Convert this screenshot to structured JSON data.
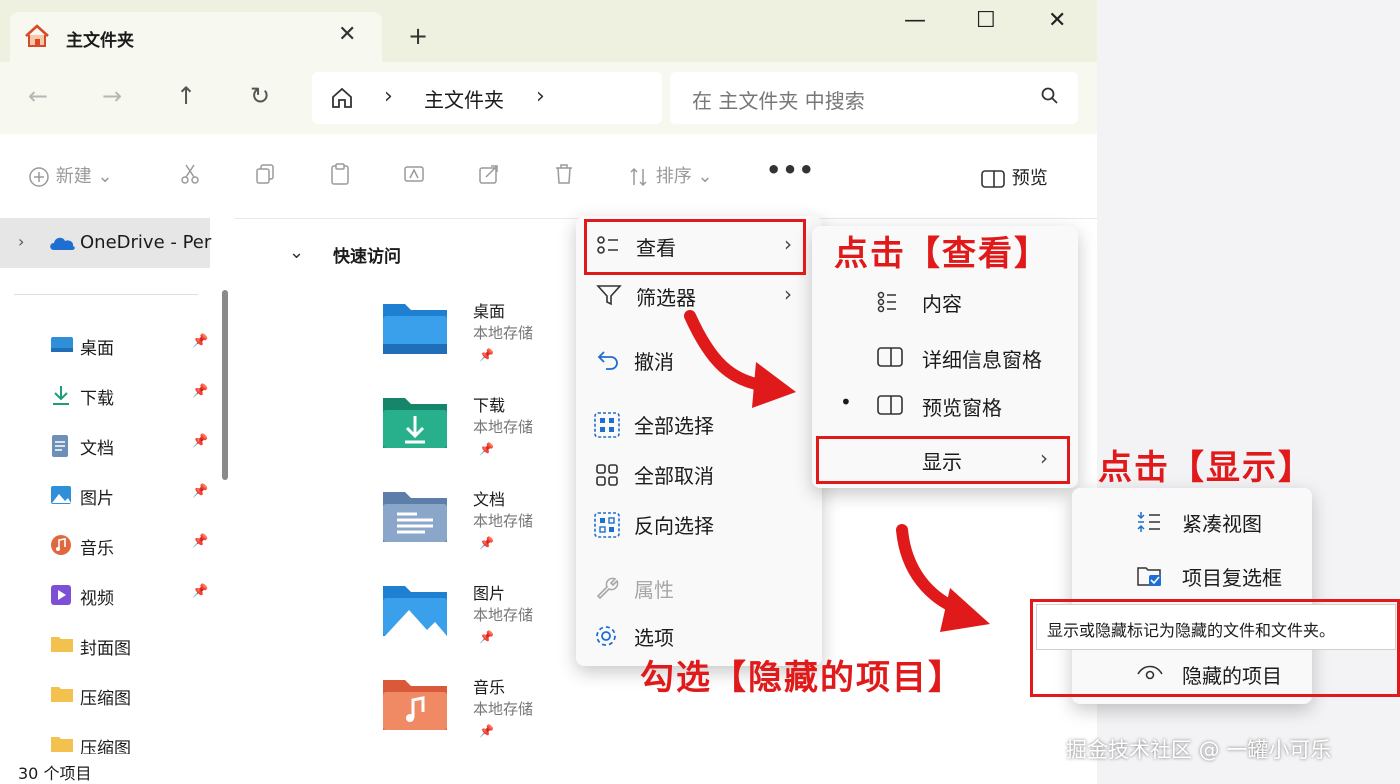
{
  "window": {
    "tab_title": "主文件夹",
    "tab_close": "✕",
    "new_tab": "+",
    "controls": {
      "minimize": "—",
      "maximize": "☐",
      "close": "✕"
    }
  },
  "nav": {
    "back": "←",
    "forward": "→",
    "up": "↑",
    "refresh": "↻",
    "address_sep": "›",
    "address": "主文件夹",
    "search_placeholder": "在 主文件夹 中搜索"
  },
  "toolbar": {
    "new_label": "新建",
    "sort_label": "排序",
    "more": "•••",
    "preview_label": "预览"
  },
  "sidebar": {
    "onedrive_label": "OneDrive - Per",
    "items": [
      {
        "label": "桌面",
        "color": "#2f8fd8"
      },
      {
        "label": "下载",
        "color": "#1d9d7a"
      },
      {
        "label": "文档",
        "color": "#6e8fb8"
      },
      {
        "label": "图片",
        "color": "#2f8fd8"
      },
      {
        "label": "音乐",
        "color": "#e0683f"
      },
      {
        "label": "视频",
        "color": "#7b4fd6"
      },
      {
        "label": "封面图",
        "color": "#f2c14e"
      },
      {
        "label": "压缩图",
        "color": "#f2c14e"
      },
      {
        "label": "压缩图",
        "color": "#f2c14e"
      }
    ]
  },
  "quick_access": {
    "heading": "快速访问",
    "folders": [
      {
        "name": "桌面",
        "location": "本地存储"
      },
      {
        "name": "下载",
        "location": "本地存储"
      },
      {
        "name": "文档",
        "location": "本地存储"
      },
      {
        "name": "图片",
        "location": "本地存储"
      },
      {
        "name": "音乐",
        "location": "本地存储"
      }
    ]
  },
  "status": {
    "item_count": "30 个项目"
  },
  "more_menu": {
    "items": [
      {
        "label": "查看",
        "submenu": true
      },
      {
        "label": "筛选器",
        "submenu": true
      },
      {
        "label": "撤消"
      },
      {
        "label": "全部选择"
      },
      {
        "label": "全部取消"
      },
      {
        "label": "反向选择"
      },
      {
        "label": "属性",
        "disabled": true
      },
      {
        "label": "选项"
      }
    ],
    "arrow": "›"
  },
  "view_menu": {
    "items": [
      {
        "label": "内容"
      },
      {
        "label": "详细信息窗格"
      },
      {
        "label": "预览窗格",
        "selected": true
      },
      {
        "label": "显示",
        "submenu": true
      }
    ],
    "bullet": "•"
  },
  "show_menu": {
    "items": [
      {
        "label": "紧凑视图"
      },
      {
        "label": "项目复选框"
      },
      {
        "label": "隐藏的项目"
      }
    ],
    "tooltip": "显示或隐藏标记为隐藏的文件和文件夹。"
  },
  "annotations": {
    "click_view": "点击【查看】",
    "click_show": "点击【显示】",
    "check_hidden": "勾选【隐藏的项目】",
    "accent": "#e01a1a"
  },
  "watermark": "掘金技术社区 @ 一罐小可乐"
}
